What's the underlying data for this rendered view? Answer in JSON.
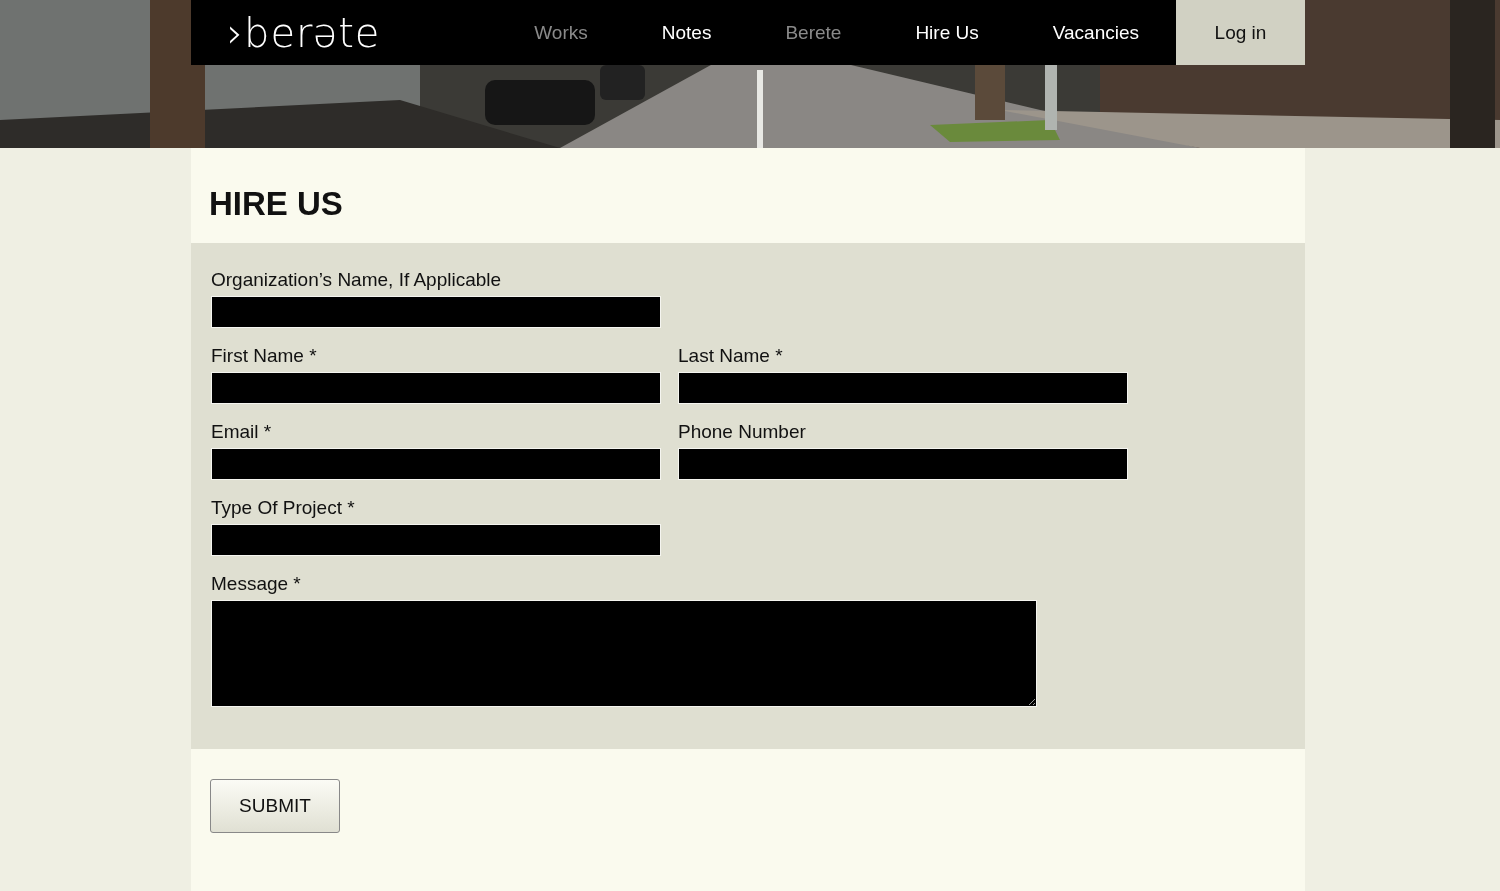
{
  "header": {
    "logo": "›berəte",
    "nav": [
      {
        "label": "Works",
        "kind": "link",
        "dimmed": true
      },
      {
        "label": "Notes",
        "kind": "link",
        "dimmed": false
      },
      {
        "label": "Berete",
        "kind": "link",
        "dimmed": true
      },
      {
        "label": "Hire Us",
        "kind": "link",
        "dimmed": false
      },
      {
        "label": "Vacancies",
        "kind": "link",
        "dimmed": false
      },
      {
        "label": "Log in",
        "kind": "button",
        "dimmed": false
      }
    ]
  },
  "page_title": "HIRE US",
  "form": {
    "rows": [
      {
        "fields": [
          {
            "label": "Organization’s Name, If Applicable",
            "kind": "input"
          }
        ]
      },
      {
        "fields": [
          {
            "label": "First Name *",
            "kind": "input"
          },
          {
            "label": "Last Name *",
            "kind": "input"
          }
        ]
      },
      {
        "fields": [
          {
            "label": "Email *",
            "kind": "input"
          },
          {
            "label": "Phone Number",
            "kind": "input"
          }
        ]
      },
      {
        "fields": [
          {
            "label": "Type Of Project *",
            "kind": "input"
          }
        ]
      },
      {
        "fields": [
          {
            "label": "Message *",
            "kind": "textarea"
          }
        ]
      }
    ],
    "submit": "SUBMIT"
  }
}
